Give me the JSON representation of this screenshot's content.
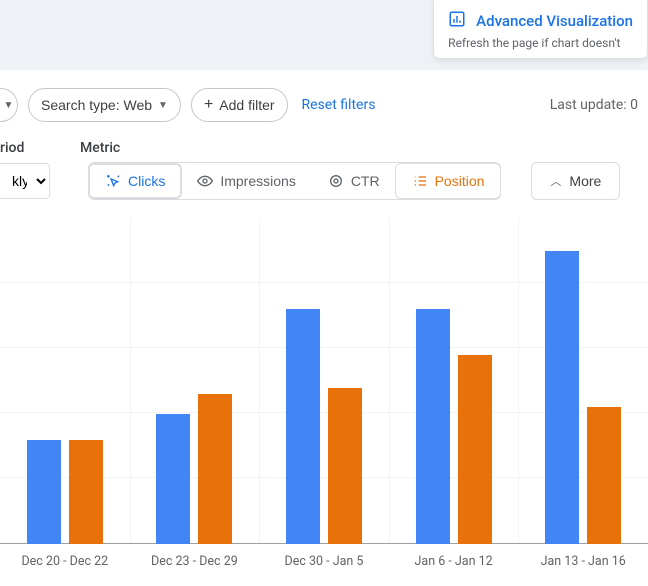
{
  "advanced_card": {
    "title": "Advanced Visualization",
    "subtitle": "Refresh the page if chart doesn't"
  },
  "toolbar": {
    "search_type_label": "Search type: Web",
    "add_filter_label": "Add filter",
    "reset_label": "Reset filters",
    "last_update_label": "Last update: 0"
  },
  "section_labels": {
    "period": "riod",
    "metric": "Metric"
  },
  "period_select": {
    "value": "kly"
  },
  "metrics": {
    "clicks": "Clicks",
    "impressions": "Impressions",
    "ctr": "CTR",
    "position": "Position",
    "more": "More"
  },
  "chart_data": {
    "type": "bar",
    "categories": [
      "Dec 20 - Dec 22",
      "Dec 23 - Dec 29",
      "Dec 30 - Jan 5",
      "Jan 6 - Jan 12",
      "Jan 13 - Jan 16"
    ],
    "series": [
      {
        "name": "Clicks",
        "color": "#4285f4",
        "values": [
          32,
          40,
          72,
          72,
          90
        ]
      },
      {
        "name": "Position",
        "color": "#e8710a",
        "values": [
          32,
          46,
          48,
          58,
          42
        ]
      }
    ],
    "ylim": [
      0,
      100
    ],
    "xlabel": "",
    "ylabel": "",
    "title": ""
  }
}
